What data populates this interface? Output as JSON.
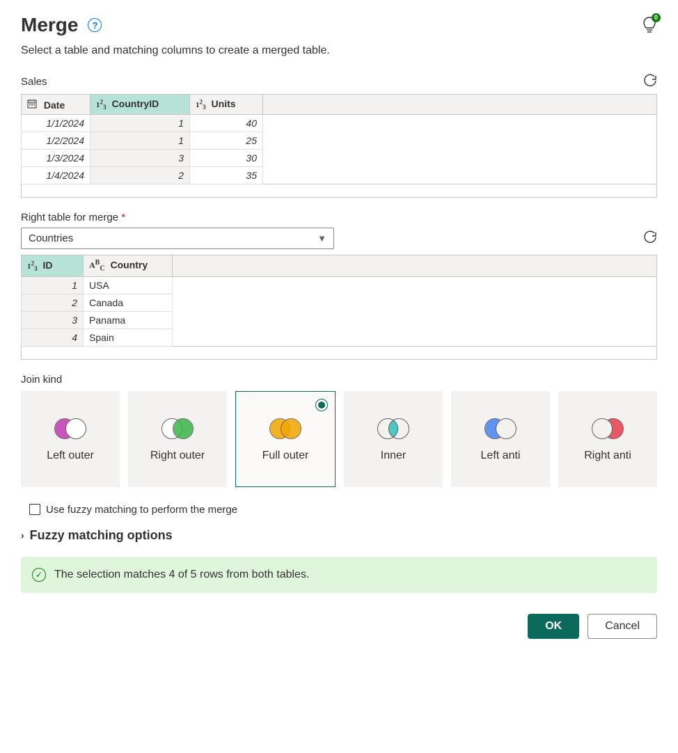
{
  "header": {
    "title": "Merge",
    "help_tooltip": "?",
    "insights_badge": "0"
  },
  "subtitle": "Select a table and matching columns to create a merged table.",
  "left_table": {
    "name": "Sales",
    "columns": [
      {
        "label": "Date",
        "type": "date",
        "selected": false
      },
      {
        "label": "CountryID",
        "type": "number",
        "selected": true
      },
      {
        "label": "Units",
        "type": "number",
        "selected": false
      }
    ],
    "rows": [
      {
        "date": "1/1/2024",
        "country_id": "1",
        "units": "40"
      },
      {
        "date": "1/2/2024",
        "country_id": "1",
        "units": "25"
      },
      {
        "date": "1/3/2024",
        "country_id": "3",
        "units": "30"
      },
      {
        "date": "1/4/2024",
        "country_id": "2",
        "units": "35"
      }
    ]
  },
  "right_table_section": {
    "label": "Right table for merge",
    "required_marker": "*",
    "selected_value": "Countries"
  },
  "right_table": {
    "columns": [
      {
        "label": "ID",
        "type": "number",
        "selected": true
      },
      {
        "label": "Country",
        "type": "text",
        "selected": false
      }
    ],
    "rows": [
      {
        "id": "1",
        "country": "USA"
      },
      {
        "id": "2",
        "country": "Canada"
      },
      {
        "id": "3",
        "country": "Panama"
      },
      {
        "id": "4",
        "country": "Spain"
      }
    ]
  },
  "join_kind": {
    "label": "Join kind",
    "options": [
      {
        "label": "Left outer",
        "key": "left-outer",
        "selected": false
      },
      {
        "label": "Right outer",
        "key": "right-outer",
        "selected": false
      },
      {
        "label": "Full outer",
        "key": "full-outer",
        "selected": true
      },
      {
        "label": "Inner",
        "key": "inner",
        "selected": false
      },
      {
        "label": "Left anti",
        "key": "left-anti",
        "selected": false
      },
      {
        "label": "Right anti",
        "key": "right-anti",
        "selected": false
      }
    ]
  },
  "fuzzy": {
    "checkbox_label": "Use fuzzy matching to perform the merge",
    "expander_label": "Fuzzy matching options"
  },
  "status": {
    "message": "The selection matches 4 of 5 rows from both tables."
  },
  "buttons": {
    "ok": "OK",
    "cancel": "Cancel"
  }
}
